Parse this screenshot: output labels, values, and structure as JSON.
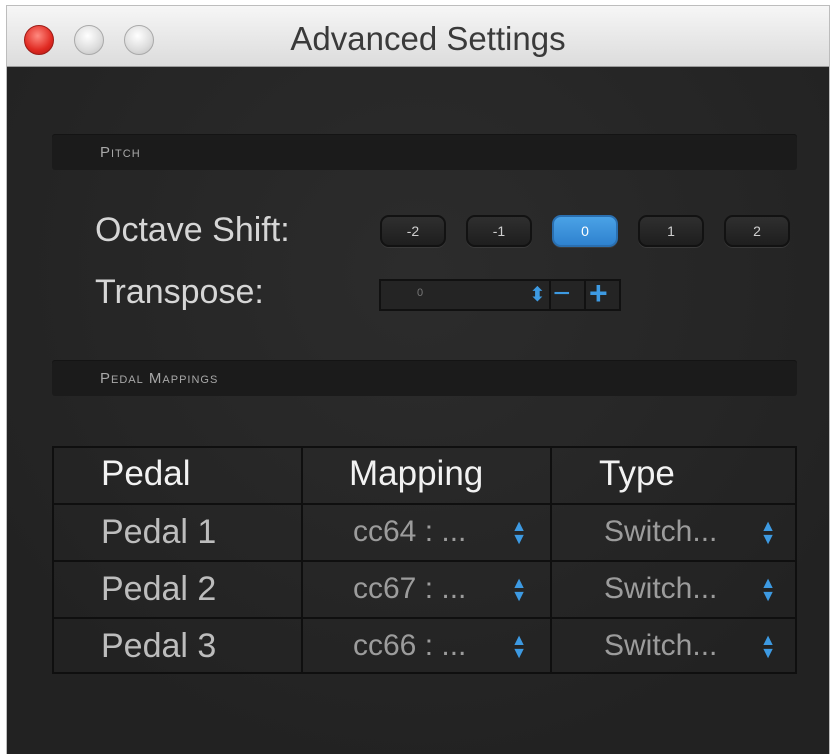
{
  "window": {
    "title": "Advanced Settings"
  },
  "pitch": {
    "header": "Pitch",
    "octave_label": "Octave Shift:",
    "octave_options": [
      "-2",
      "-1",
      "0",
      "1",
      "2"
    ],
    "octave_selected": "0",
    "transpose_label": "Transpose:",
    "transpose_value": "0",
    "minus_label": "−",
    "plus_label": "+"
  },
  "pedals": {
    "header": "Pedal Mappings",
    "columns": [
      "Pedal",
      "Mapping",
      "Type"
    ],
    "rows": [
      {
        "pedal": "Pedal 1",
        "mapping": "cc64 : ...",
        "type": "Switch..."
      },
      {
        "pedal": "Pedal 2",
        "mapping": "cc67 : ...",
        "type": "Switch..."
      },
      {
        "pedal": "Pedal 3",
        "mapping": "cc66 : ...",
        "type": "Switch..."
      }
    ]
  },
  "colors": {
    "accent": "#3d9ae2",
    "background": "#2a2a2a"
  }
}
